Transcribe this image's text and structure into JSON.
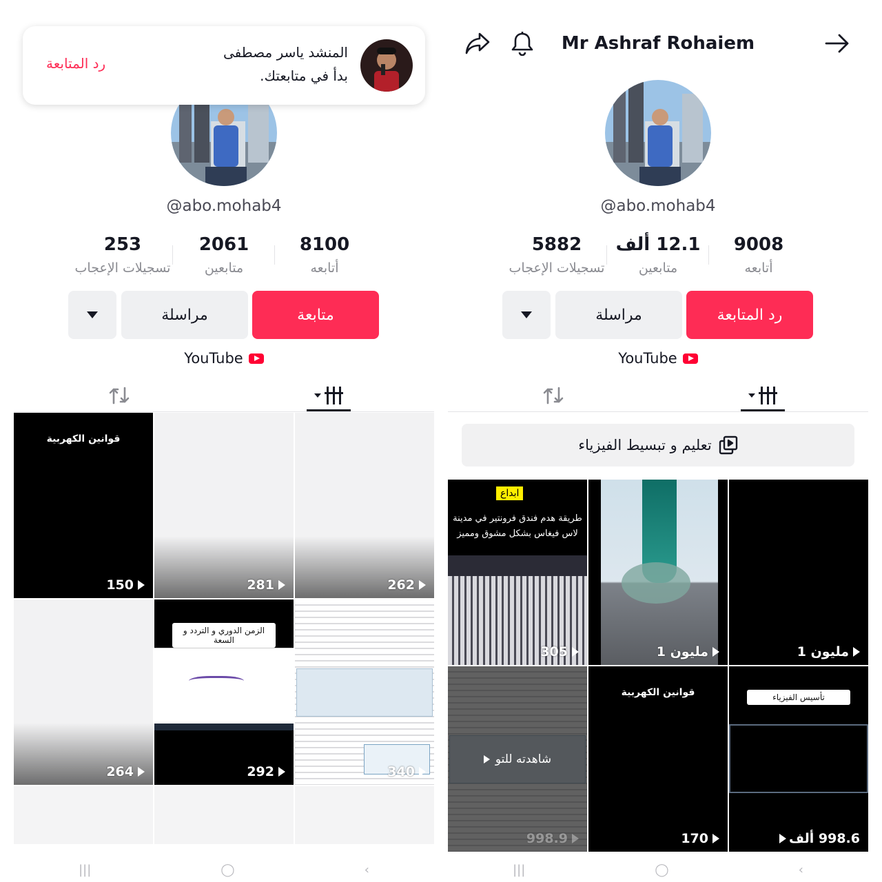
{
  "left": {
    "username": "@abo.mohab4",
    "stats": {
      "following": {
        "value": "8100",
        "label": "أتابعه"
      },
      "followers": {
        "value": "2061",
        "label": "متابعين"
      },
      "likes": {
        "value": "253",
        "label": "تسجيلات الإعجاب"
      }
    },
    "buttons": {
      "primary": "متابعة",
      "message": "مراسلة"
    },
    "link": "YouTube",
    "notification": {
      "name": "المنشد ياسر مصطفى",
      "message": "بدأ في متابعتك.",
      "action": "رد المتابعة"
    },
    "videos": [
      {
        "views": "150",
        "title": "قوانين الكهربية"
      },
      {
        "views": "281"
      },
      {
        "views": "262"
      },
      {
        "views": "264"
      },
      {
        "views": "292",
        "title": "الزمن الدوري و التردد و السعة"
      },
      {
        "views": "340"
      }
    ]
  },
  "right": {
    "header_title": "Mr Ashraf Rohaiem",
    "username": "@abo.mohab4",
    "stats": {
      "following": {
        "value": "9008",
        "label": "أتابعه"
      },
      "followers": {
        "value": "12.1 ألف",
        "label": "متابعين"
      },
      "likes": {
        "value": "5882",
        "label": "تسجيلات الإعجاب"
      }
    },
    "buttons": {
      "primary": "رد المتابعة",
      "message": "مراسلة"
    },
    "link": "YouTube",
    "playlist": "تعليم و تبسيط الفيزياء",
    "videos": [
      {
        "views": "305",
        "badge": "ابداع",
        "caption": "طريقة هدم فندق فرونتير في مدينة لاس فيغاس بشكل مشوق ومميز"
      },
      {
        "views": "1 مليون"
      },
      {
        "views": "1 مليون"
      },
      {
        "views": "998.9",
        "watched": "شاهدته للتو"
      },
      {
        "views": "170",
        "title": "قوانين الكهربية"
      },
      {
        "views": "998.6 ألف",
        "title": "تأسيس الفيزياء"
      }
    ]
  },
  "icons": {
    "share": "share-icon",
    "bell": "bell-icon",
    "back": "arrow-right-icon",
    "repost": "repost-icon",
    "grid": "grid-icon",
    "playlist": "playlist-icon",
    "play": "play-icon"
  },
  "colors": {
    "accent": "#fe2c55",
    "youtube": "#ff0033",
    "text": "#161823",
    "muted": "#8a8b91"
  }
}
